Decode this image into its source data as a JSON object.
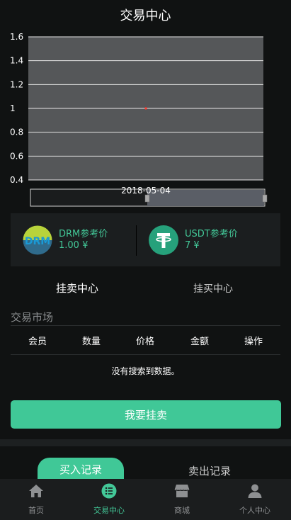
{
  "header": {
    "title": "交易中心"
  },
  "chart_data": {
    "type": "line",
    "title": "",
    "xlabel": "",
    "ylabel": "",
    "x": [
      "2018-05-04"
    ],
    "series": [
      {
        "values": [
          1.0
        ]
      }
    ],
    "ylim": [
      0.4,
      1.6
    ],
    "yticks": [
      "1.6",
      "1.4",
      "1.2",
      "1",
      "0.8",
      "0.6",
      "0.4"
    ],
    "grid": true,
    "range_slider_label": "2018-05-04",
    "colors": {
      "plot_bg": "#555759",
      "grid": "#e6e6e6",
      "point": "#ff3b30"
    }
  },
  "prices": {
    "drm": {
      "label": "DRM参考价",
      "value": "1.00 ¥",
      "logo_text": "DRM",
      "icon": "drm-logo"
    },
    "usdt": {
      "label": "USDT参考价",
      "value": "7 ¥",
      "logo_text": "T",
      "icon": "tether-logo"
    }
  },
  "tabs": {
    "sell_center": "挂卖中心",
    "buy_center": "挂买中心"
  },
  "market": {
    "title": "交易市场",
    "columns": [
      "会员",
      "数量",
      "价格",
      "金额",
      "操作"
    ],
    "empty_text": "没有搜索到数据。"
  },
  "actions": {
    "sell_button": "我要挂卖"
  },
  "records": {
    "buy_tab": "买入记录",
    "sell_tab": "卖出记录"
  },
  "nav": [
    {
      "label": "首页",
      "icon": "home-icon"
    },
    {
      "label": "交易中心",
      "icon": "trade-icon"
    },
    {
      "label": "商城",
      "icon": "shop-icon"
    },
    {
      "label": "个人中心",
      "icon": "user-icon"
    }
  ],
  "colors": {
    "accent": "#40c897",
    "background": "#101212",
    "panel": "#1b1e1f"
  }
}
